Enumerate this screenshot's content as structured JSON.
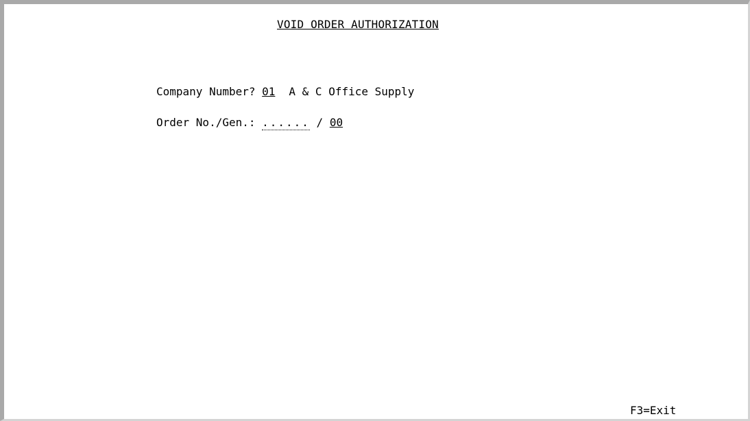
{
  "screen": {
    "title": "VOID ORDER AUTHORIZATION"
  },
  "company": {
    "label": "Company Number? ",
    "value": "01",
    "name": "A & C Office Supply"
  },
  "order": {
    "label": "Order No./Gen.: ",
    "number_placeholder": "......",
    "separator": " / ",
    "generation_value": "00"
  },
  "function_keys": {
    "exit_label": "F3=Exit"
  }
}
